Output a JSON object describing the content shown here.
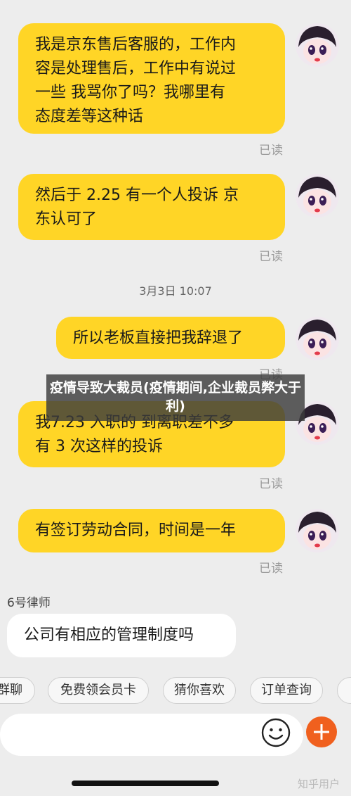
{
  "messages": [
    {
      "text": "我是京东售后客服的，工作内\n容是处理售后，工作中有说过\n一些 我骂你了吗？我哪里有\n态度差等这种话",
      "status": "已读"
    },
    {
      "text": "然后于 2.25 有一个人投诉 京\n东认可了",
      "status": "已读"
    },
    {
      "text": "所以老板直接把我辞退了",
      "status": "已读"
    },
    {
      "text": "我7.23 入职的 到离职差不多\n有 3 次这样的投诉",
      "status": "已读"
    },
    {
      "text": "有签订劳动合同，时间是一年",
      "status": "已读"
    }
  ],
  "timestamp": "3月3日 10:07",
  "lawyer": {
    "name": "6号律师",
    "message": "公司有相应的管理制度吗"
  },
  "overlay_title": "疫情导致大裁员(疫情期间,企业裁员弊大于利)",
  "quick_replies": [
    "群聊",
    "免费领会员卡",
    "猜你喜欢",
    "订单查询"
  ],
  "input": {
    "placeholder": ""
  },
  "watermark": "知乎用户",
  "colors": {
    "bubble": "#ffd526",
    "background": "#ededed",
    "plus": "#f0601e"
  },
  "icons": {
    "emoji": "smiley-icon",
    "plus": "plus-icon"
  }
}
